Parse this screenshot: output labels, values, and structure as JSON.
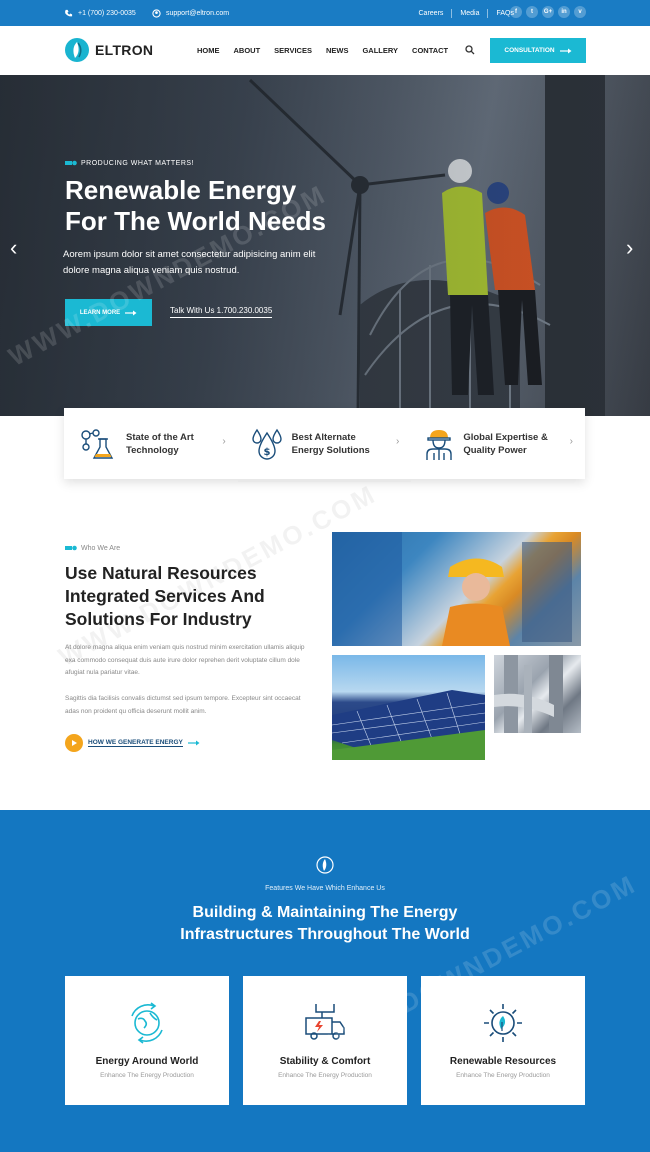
{
  "topbar": {
    "phone": "+1 (700) 230-0035",
    "email": "support@eltron.com",
    "links": [
      "Careers",
      "Media",
      "FAQs"
    ],
    "social": [
      "f",
      "t",
      "G+",
      "in",
      "v"
    ]
  },
  "header": {
    "brand": "ELTRON",
    "nav": [
      "HOME",
      "ABOUT",
      "SERVICES",
      "NEWS",
      "GALLERY",
      "CONTACT"
    ],
    "cta_label": "CONSULTATION"
  },
  "hero": {
    "eyebrow": "PRODUCING WHAT MATTERS!",
    "title_line1": "Renewable Energy",
    "title_line2": "For The World Needs",
    "subtitle": "Aorem ipsum dolor sit amet consectetur adipisicing anim elit dolore magna aliqua veniam quis nostrud.",
    "button_label": "LEARN MORE",
    "talk_label": "Talk With Us 1.700.230.0035",
    "prev_arrow": "‹",
    "next_arrow": "›"
  },
  "features": [
    {
      "line1": "State of the Art",
      "line2": "Technology",
      "icon": "molecule-flask-icon"
    },
    {
      "line1": "Best Alternate",
      "line2": "Energy Solutions",
      "icon": "water-drops-dollar-icon"
    },
    {
      "line1": "Global Expertise &",
      "line2": "Quality Power",
      "icon": "engineer-icon"
    }
  ],
  "who": {
    "eyebrow": "Who We Are",
    "title": "Use Natural Resources Integrated Services And Solutions For Industry",
    "para1": "At dolore magna aliqua enim veniam quis nostrud minim exercitation ullamis aliquip exa commodo consequat duis aute irure dolor reprehen derit voluptate cillum dole afugiat nula pariatur vitae.",
    "para2": "Sagittis dia facilisis convalis dictumst sed ipsum tempore. Excepteur sint occaecat adas non proident qu officia deserunt mollit anim.",
    "link_label": "HOW WE GENERATE ENERGY"
  },
  "services": {
    "eyebrow": "Features We Have Which Enhance Us",
    "title_line1": "Building & Maintaining The Energy",
    "title_line2": "Infrastructures Throughout The World",
    "cards": [
      {
        "title": "Energy Around World",
        "sub": "Enhance The Energy Production",
        "icon": "globe-cycle-icon"
      },
      {
        "title": "Stability & Comfort",
        "sub": "Enhance The Energy Production",
        "icon": "electric-truck-icon"
      },
      {
        "title": "Renewable Resources",
        "sub": "Enhance The Energy Production",
        "icon": "gear-leaf-icon"
      }
    ]
  },
  "watermark_text": "WWW.DOWNDEMO.COM",
  "colors": {
    "primary_blue": "#1477c1",
    "accent_cyan": "#1bb9d3",
    "accent_orange": "#f4a51c"
  }
}
